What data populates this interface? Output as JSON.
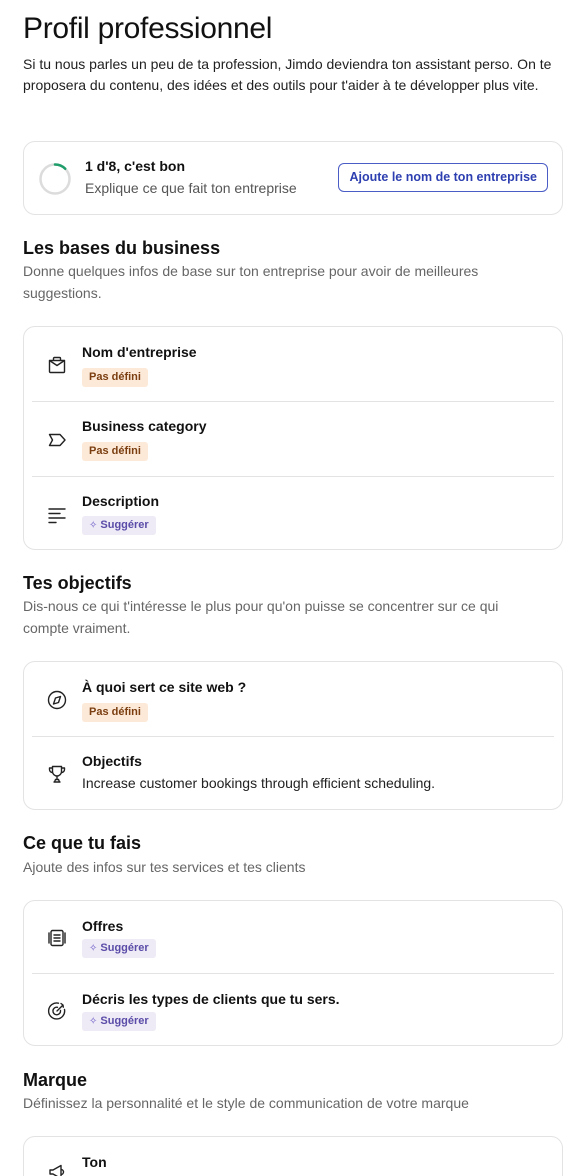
{
  "header": {
    "title": "Profil professionnel",
    "intro": "Si tu nous parles un peu de ta profession, Jimdo deviendra ton assistant perso. On te proposera du contenu, des idées et des outils pour t'aider à te développer plus vite."
  },
  "progress": {
    "title": "1 d'8, c'est bon",
    "subtitle": "Explique ce que fait ton entreprise",
    "button_label": "Ajoute le nom de ton entreprise",
    "completed": 1,
    "total": 8,
    "accent_color": "#1f9d6b"
  },
  "badges": {
    "undefined_label": "Pas défini",
    "suggest_label": "Suggérer",
    "suggest_icon": "sparkle-icon"
  },
  "sections": {
    "business": {
      "title": "Les bases du business",
      "description": "Donne quelques infos de base sur ton entreprise pour avoir de meilleures suggestions.",
      "items": [
        {
          "label": "Nom d'entreprise",
          "icon": "briefcase-icon",
          "status": "Pas défini"
        },
        {
          "label": "Business category",
          "icon": "tag-icon",
          "status": "Pas défini"
        },
        {
          "label": "Description",
          "icon": "text-lines-icon",
          "status": "Suggérer"
        }
      ]
    },
    "goals": {
      "title": "Tes objectifs",
      "description": "Dis-nous ce qui t'intéresse le plus pour qu'on puisse se concentrer sur ce qui compte vraiment.",
      "items": [
        {
          "label": "À quoi sert ce site web ?",
          "icon": "compass-icon",
          "status": "Pas défini"
        },
        {
          "label": "Objectifs",
          "icon": "trophy-icon",
          "value": "Increase customer bookings through efficient scheduling."
        }
      ]
    },
    "work": {
      "title": "Ce que tu fais",
      "description": "Ajoute des infos sur tes services et tes clients",
      "items": [
        {
          "label": "Offres",
          "icon": "offers-list-icon",
          "status": "Suggérer"
        },
        {
          "label": "Décris les types de clients que tu sers.",
          "icon": "target-icon",
          "status": "Suggérer"
        }
      ]
    },
    "brand": {
      "title": "Marque",
      "description": "Définissez la personnalité et le style de communication de votre marque",
      "items": [
        {
          "label": "Ton",
          "icon": "megaphone-icon"
        }
      ]
    }
  }
}
